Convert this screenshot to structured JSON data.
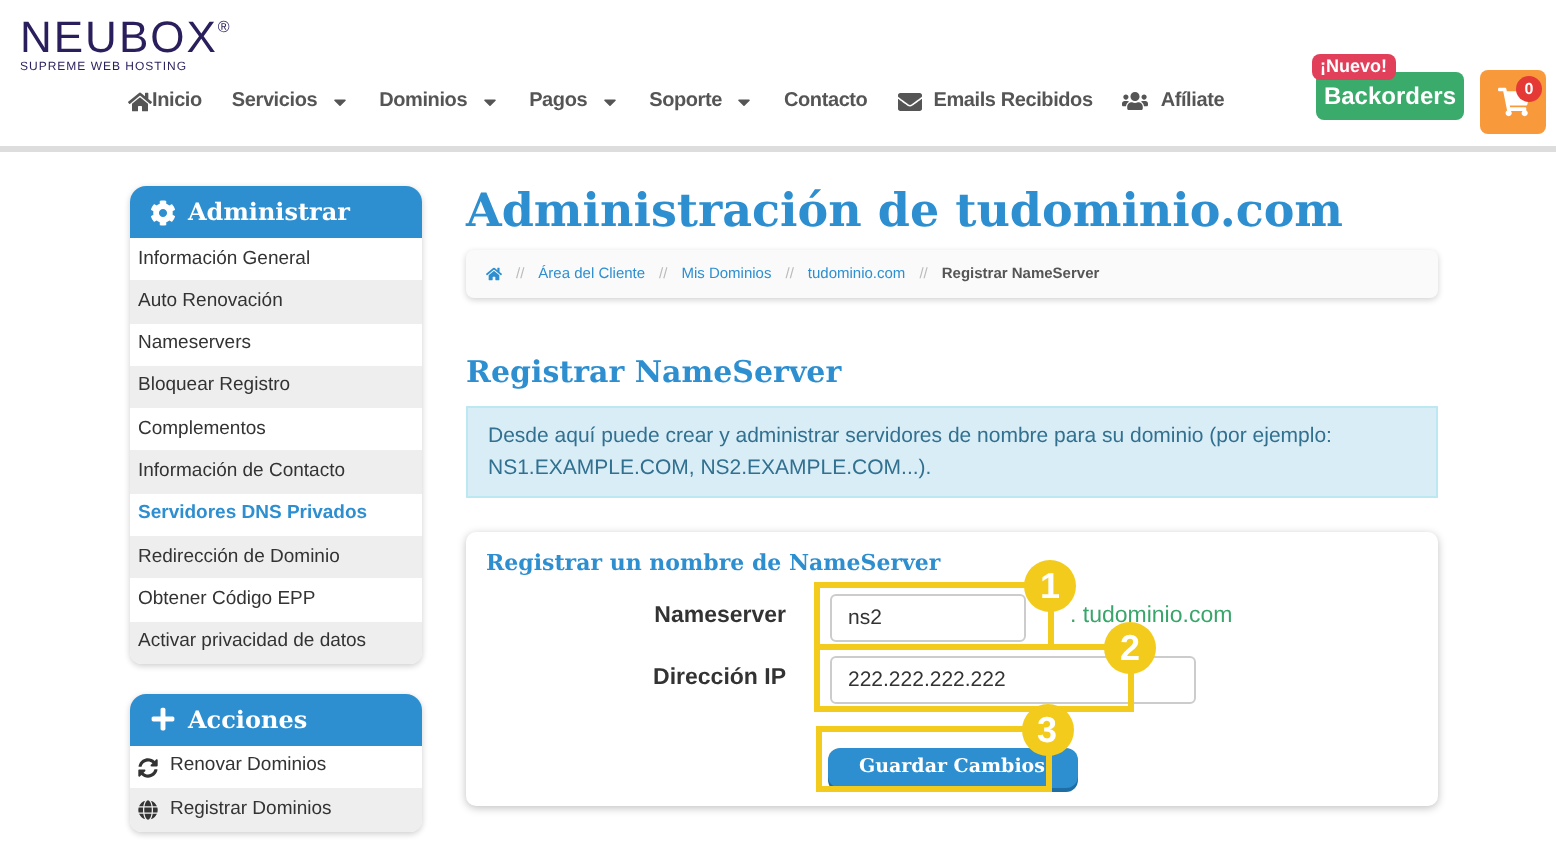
{
  "logo": {
    "name": "NEUBOX",
    "trademark": "®",
    "tagline": "SUPREME WEB HOSTING"
  },
  "nav": [
    {
      "label": "Inicio",
      "kind": "home",
      "has_menu": false
    },
    {
      "label": "Servicios",
      "kind": "plain",
      "has_menu": true
    },
    {
      "label": "Dominios",
      "kind": "plain",
      "has_menu": true
    },
    {
      "label": "Pagos",
      "kind": "plain",
      "has_menu": true
    },
    {
      "label": "Soporte",
      "kind": "plain",
      "has_menu": true
    },
    {
      "label": "Contacto",
      "kind": "plain",
      "has_menu": false
    },
    {
      "label": "Emails Recibidos",
      "kind": "mail",
      "has_menu": false
    },
    {
      "label": "Afíliate",
      "kind": "users",
      "has_menu": false
    }
  ],
  "backorders": {
    "badge": "¡Nuevo!",
    "label": "Backorders"
  },
  "cart": {
    "count": "0"
  },
  "sidebar": [
    {
      "title": "Administrar",
      "kind": "gear",
      "items": [
        {
          "label": "Información General",
          "selected": false
        },
        {
          "label": "Auto Renovación",
          "selected": false
        },
        {
          "label": "Nameservers",
          "selected": false
        },
        {
          "label": "Bloquear Registro",
          "selected": false
        },
        {
          "label": "Complementos",
          "selected": false
        },
        {
          "label": "Información de Contacto",
          "selected": false
        },
        {
          "label": "Servidores DNS Privados",
          "selected": true
        },
        {
          "label": "Redirección de Dominio",
          "selected": false
        },
        {
          "label": "Obtener Código EPP",
          "selected": false
        },
        {
          "label": "Activar privacidad de datos",
          "selected": false
        }
      ]
    },
    {
      "title": "Acciones",
      "kind": "plus",
      "items": [
        {
          "label": "Renovar Dominios",
          "kind": "refresh",
          "selected": false
        },
        {
          "label": "Registrar Dominios",
          "kind": "globe",
          "selected": false
        }
      ]
    }
  ],
  "page_title": "Administración de tudominio.com",
  "breadcrumb_separator": "//",
  "breadcrumb": [
    "Área del Cliente",
    "Mis Dominios",
    "tudominio.com",
    "Registrar NameServer"
  ],
  "section_title": "Registrar NameServer",
  "info": "Desde aquí puede crear y administrar servidores de nombre para su dominio (por ejemplo: NS1.EXAMPLE.COM, NS2.EXAMPLE.COM...).",
  "form": {
    "title": "Registrar un nombre de NameServer",
    "fields": [
      {
        "label": "Nameserver",
        "value": "ns2",
        "suffix": ". tudominio.com",
        "annotation": "1"
      },
      {
        "label": "Dirección IP",
        "value": "222.222.222.222",
        "annotation": "2"
      }
    ],
    "button": {
      "label": "Guardar Cambios",
      "annotation": "3"
    }
  }
}
